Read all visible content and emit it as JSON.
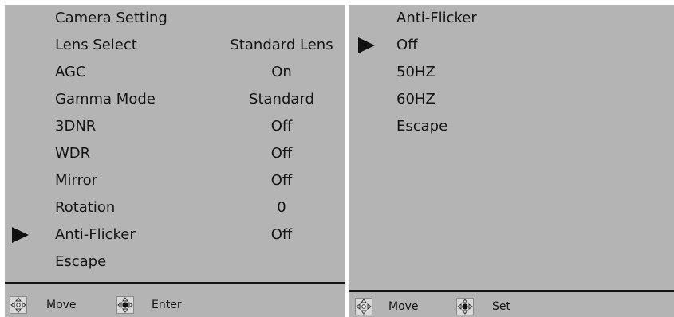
{
  "camera_menu": {
    "title": "Camera Setting",
    "items": [
      {
        "label": "Lens Select",
        "value": "Standard Lens"
      },
      {
        "label": "AGC",
        "value": "On"
      },
      {
        "label": "Gamma Mode",
        "value": "Standard"
      },
      {
        "label": "3DNR",
        "value": "Off"
      },
      {
        "label": "WDR",
        "value": "Off"
      },
      {
        "label": "Mirror",
        "value": "Off"
      },
      {
        "label": "Rotation",
        "value": "0"
      },
      {
        "label": "Anti-Flicker",
        "value": "Off",
        "selected": true
      },
      {
        "label": "Escape",
        "value": ""
      }
    ],
    "footer": {
      "move_icon": "four-direction-arrows-icon",
      "move_label": "Move",
      "enter_icon": "joystick-press-icon",
      "enter_label": "Enter"
    }
  },
  "anti_flicker_menu": {
    "title": "Anti-Flicker",
    "options": [
      {
        "label": "Off",
        "selected": true
      },
      {
        "label": "50HZ"
      },
      {
        "label": "60HZ"
      },
      {
        "label": "Escape"
      }
    ],
    "footer": {
      "move_icon": "four-direction-arrows-icon",
      "move_label": "Move",
      "set_icon": "joystick-press-icon",
      "set_label": "Set"
    }
  },
  "colors": {
    "panel_background": "#b4b4b4",
    "text": "#141414",
    "pointer": "#111111"
  }
}
